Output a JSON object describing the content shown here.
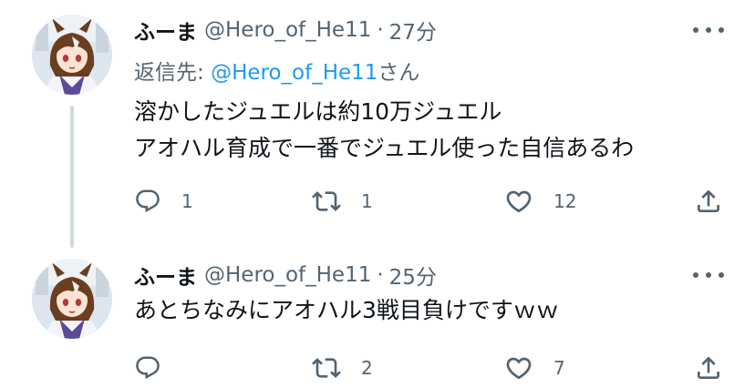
{
  "tweets": [
    {
      "display_name": "ふーま",
      "handle": "@Hero_of_He11",
      "separator": "·",
      "time": "27分",
      "reply_to": {
        "label": "返信先: ",
        "mention": "@Hero_of_He11",
        "suffix": "さん"
      },
      "lines": [
        "溶かしたジュエルは約10万ジュエル",
        "アオハル育成で一番でジュエル使った自信あるわ"
      ],
      "actions": {
        "reply_icon": "reply-icon",
        "reply_count": "1",
        "retweet_icon": "retweet-icon",
        "retweet_count": "1",
        "like_icon": "heart-icon",
        "like_count": "12",
        "share_icon": "share-icon"
      }
    },
    {
      "display_name": "ふーま",
      "handle": "@Hero_of_He11",
      "separator": "·",
      "time": "25分",
      "lines": [
        "あとちなみにアオハル3戦目負けですｗｗ"
      ],
      "actions": {
        "reply_icon": "reply-icon",
        "reply_count": "",
        "retweet_icon": "retweet-icon",
        "retweet_count": "2",
        "like_icon": "heart-icon",
        "like_count": "7",
        "share_icon": "share-icon"
      }
    }
  ],
  "colors": {
    "text": "#0f1419",
    "secondary": "#536471",
    "link": "#1d9bf0",
    "thread_line": "#cfd9de"
  }
}
